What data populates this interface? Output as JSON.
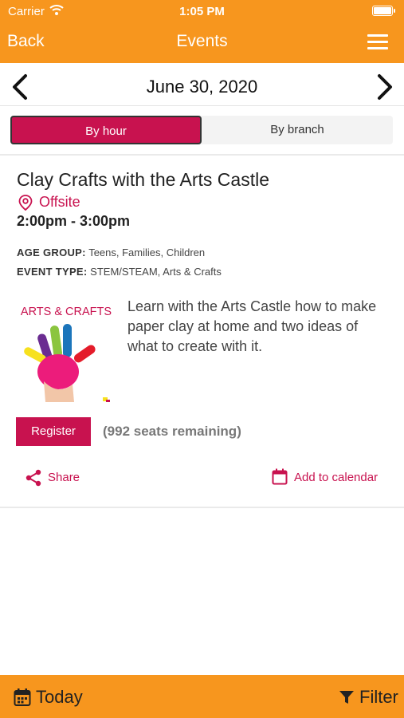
{
  "status_bar": {
    "carrier": "Carrier",
    "time": "1:05 PM"
  },
  "nav": {
    "back_label": "Back",
    "title": "Events"
  },
  "date_bar": {
    "date": "June 30, 2020"
  },
  "segment": {
    "by_hour": "By hour",
    "by_branch": "By branch",
    "selected": "By hour"
  },
  "event": {
    "title": "Clay Crafts with the Arts Castle",
    "location": "Offsite",
    "time": "2:00pm - 3:00pm",
    "age_group_label": "AGE GROUP:",
    "age_group_value": "Teens, Families, Children",
    "event_type_label": "EVENT TYPE:",
    "event_type_value": "STEM/STEAM, Arts & Crafts",
    "image_caption": "ARTS & CRAFTS",
    "description": "Learn with the Arts Castle how to make paper clay at home and two ideas of what to create with it.",
    "register_label": "Register",
    "seats": "(992 seats remaining)",
    "share_label": "Share",
    "calendar_label": "Add to calendar"
  },
  "bottom_bar": {
    "today_label": "Today",
    "filter_label": "Filter"
  },
  "colors": {
    "brand_orange": "#F7961E",
    "accent_magenta": "#C8124F"
  },
  "icons": [
    "wifi-icon",
    "battery-icon",
    "menu-icon",
    "chevron-left-icon",
    "chevron-right-icon",
    "location-pin-icon",
    "share-icon",
    "calendar-icon",
    "filter-icon"
  ]
}
